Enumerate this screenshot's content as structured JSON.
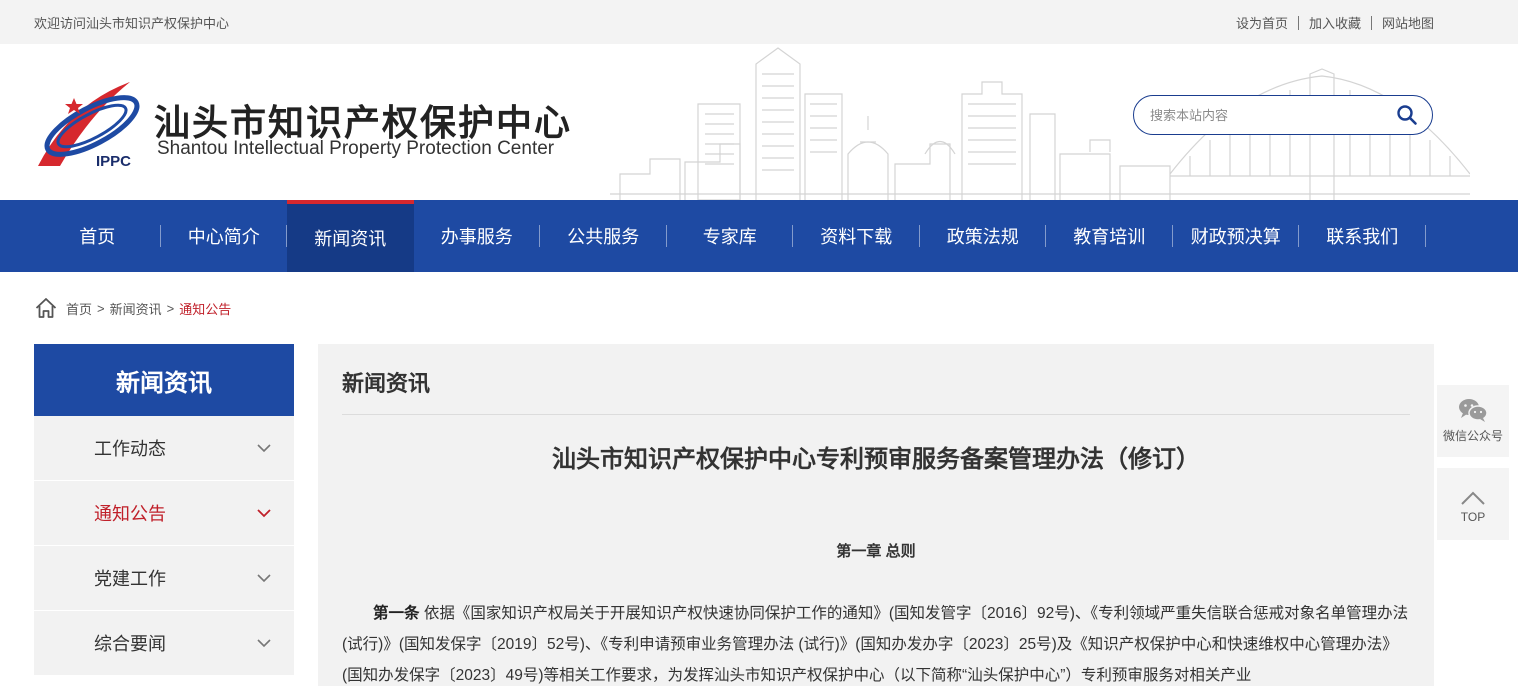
{
  "topbar": {
    "welcome": "欢迎访问汕头市知识产权保护中心",
    "links": [
      "设为首页",
      "加入收藏",
      "网站地图"
    ]
  },
  "header": {
    "logo_badge": "IPPC",
    "title_cn": "汕头市知识产权保护中心",
    "title_en": "Shantou Intellectual Property Protection Center",
    "search_placeholder": "搜索本站内容"
  },
  "nav": {
    "items": [
      "首页",
      "中心简介",
      "新闻资讯",
      "办事服务",
      "公共服务",
      "专家库",
      "资料下载",
      "政策法规",
      "教育培训",
      "财政预决算",
      "联系我们"
    ],
    "active": "新闻资讯"
  },
  "breadcrumb": {
    "items": [
      "首页",
      "新闻资讯",
      "通知公告"
    ],
    "separator": ">"
  },
  "sidebar": {
    "title": "新闻资讯",
    "items": [
      "工作动态",
      "通知公告",
      "党建工作",
      "综合要闻"
    ],
    "active": "通知公告"
  },
  "main": {
    "section_title": "新闻资讯",
    "article_title": "汕头市知识产权保护中心专利预审服务备案管理办法（修订）",
    "chapter": "第一章  总则",
    "para_lead": "第一条",
    "para_body": " 依据《国家知识产权局关于开展知识产权快速协同保护工作的通知》(国知发管字〔2016〕92号)、《专利领域严重失信联合惩戒对象名单管理办法(试行)》(国知发保字〔2019〕52号)、《专利申请预审业务管理办法 (试行)》(国知办发办字〔2023〕25号)及《知识产权保护中心和快速维权中心管理办法》(国知办发保字〔2023〕49号)等相关工作要求，为发挥汕头市知识产权保护中心（以下简称“汕头保护中心”）专利预审服务对相关产业"
  },
  "float": {
    "wechat_label": "微信公众号",
    "top_label": "TOP"
  },
  "colors": {
    "primary": "#1e4aa3",
    "primary_dark": "#153a86",
    "accent_red": "#c0202a",
    "panel_bg": "#f2f2f2"
  },
  "icons": [
    "search-icon",
    "home-icon",
    "chevron-down-icon",
    "wechat-icon",
    "chevron-up-icon"
  ]
}
